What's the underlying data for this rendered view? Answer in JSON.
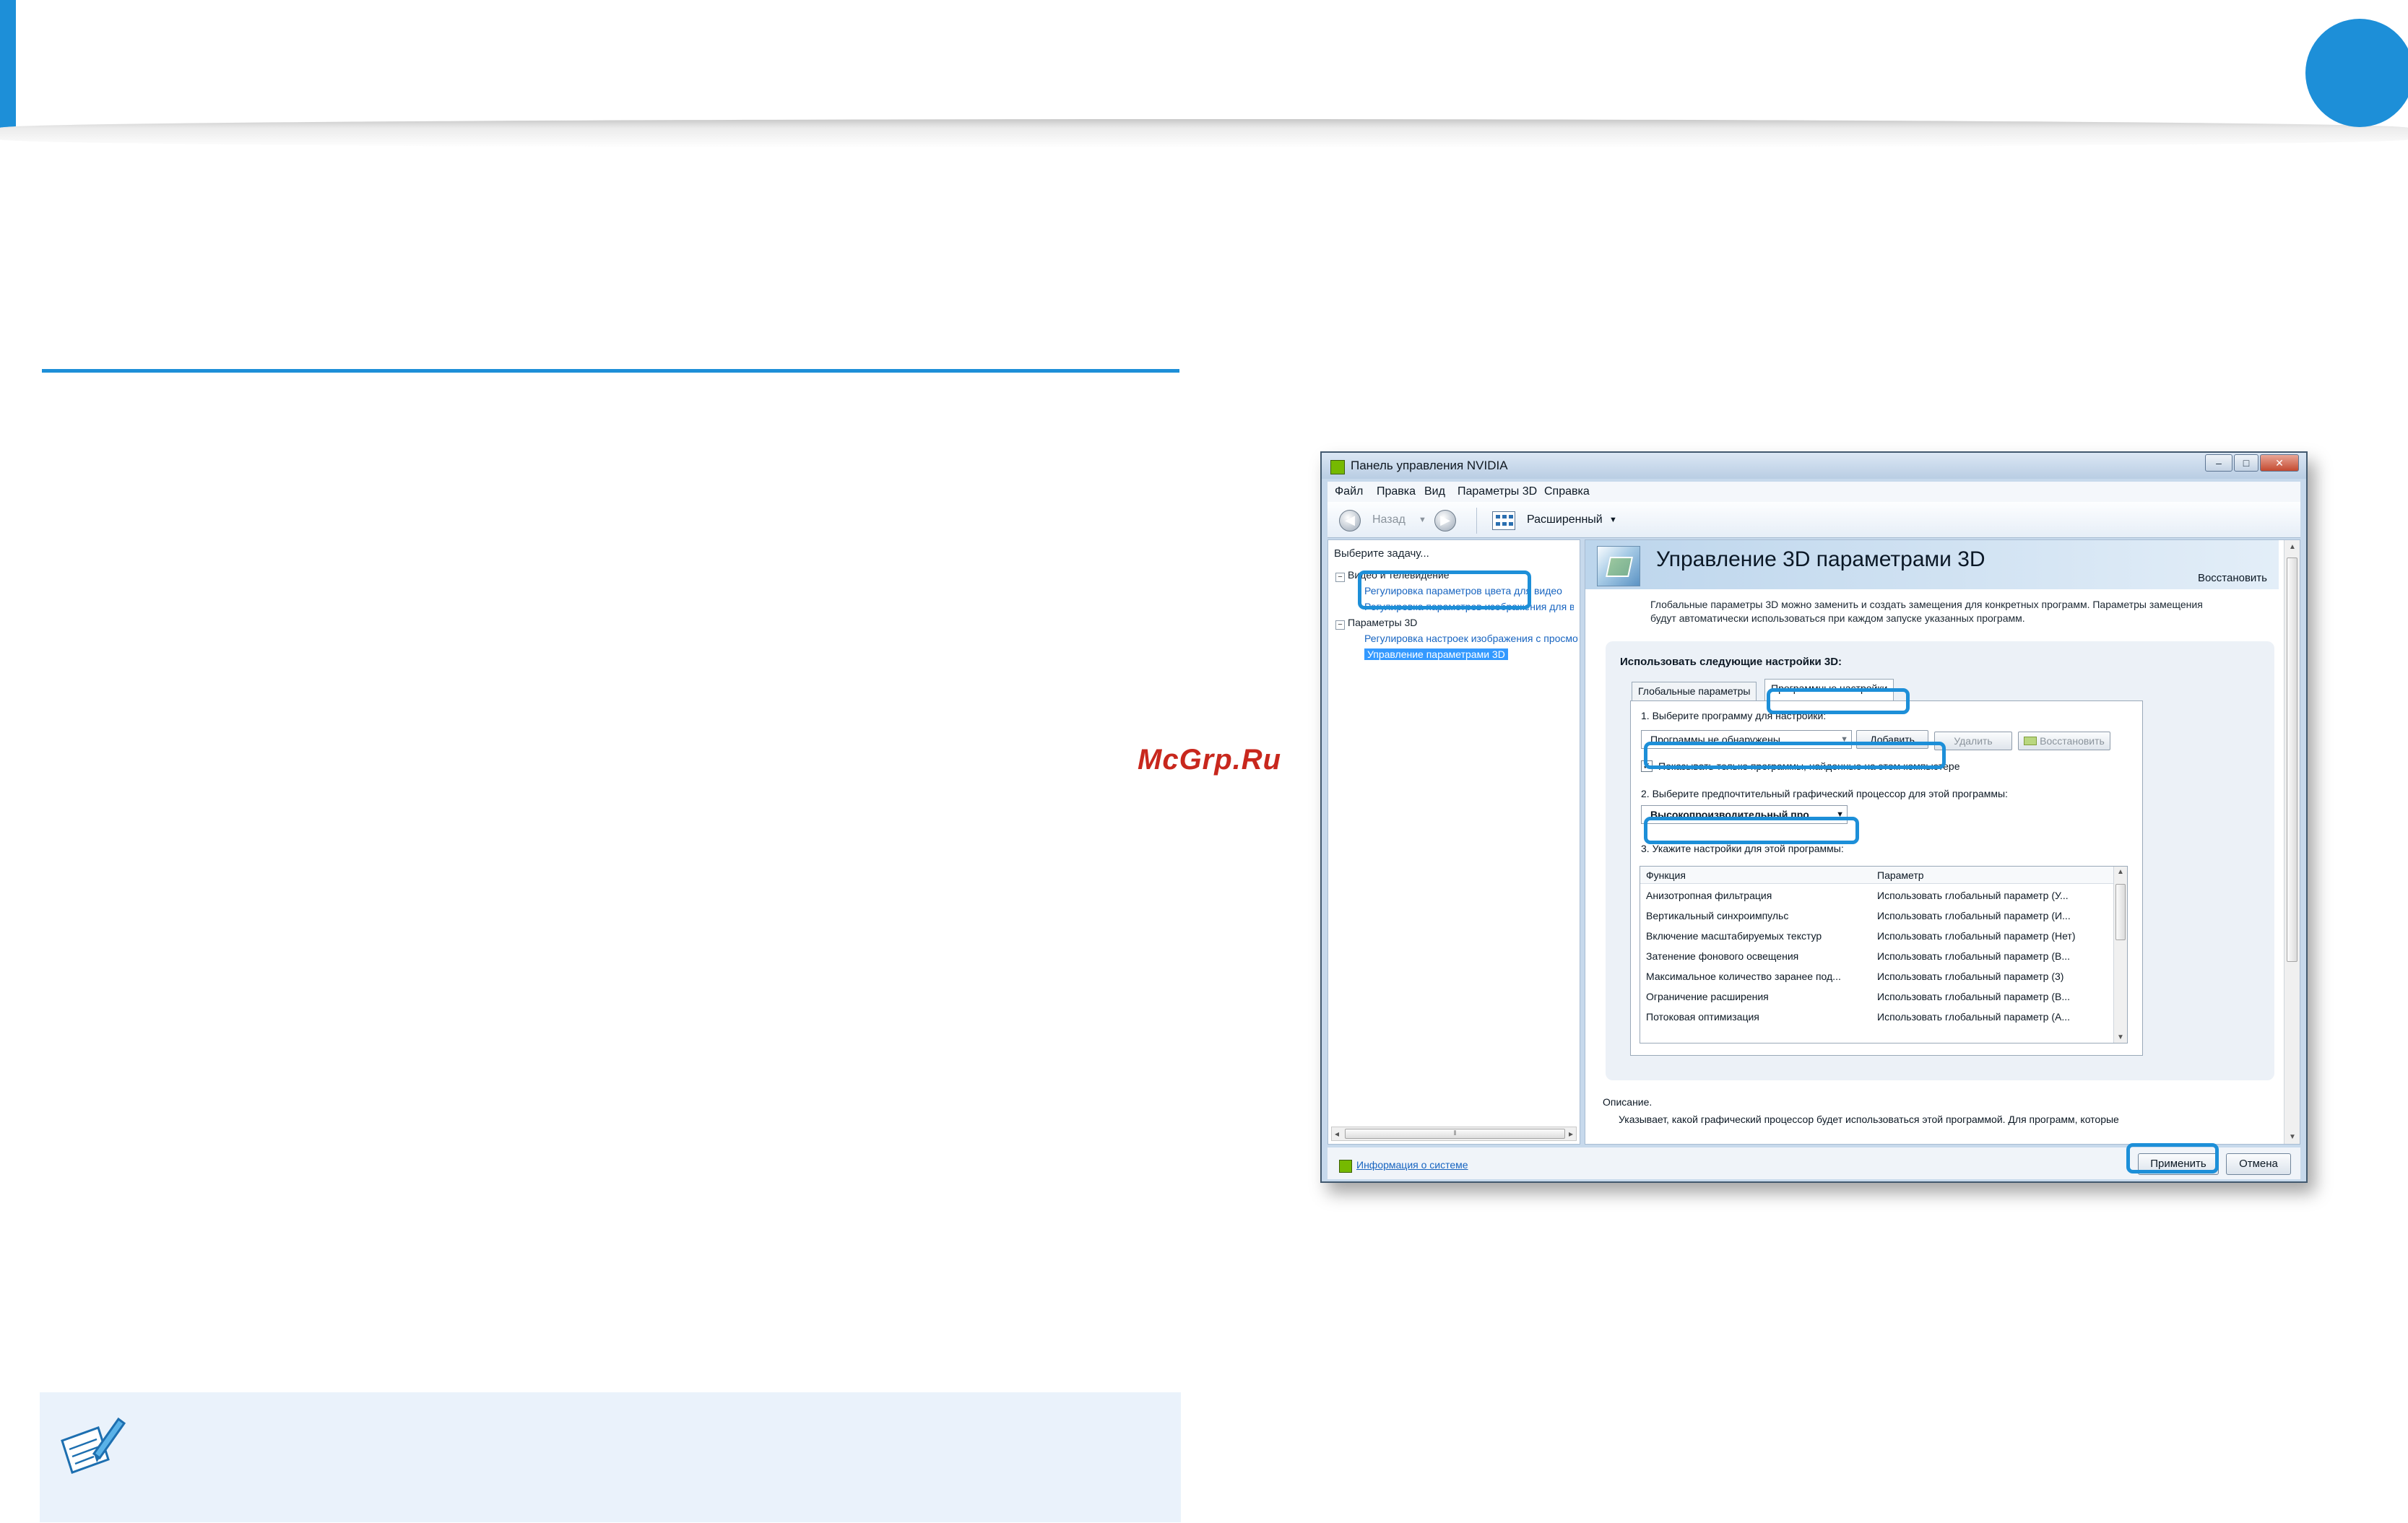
{
  "watermark": "McGrp.Ru",
  "window": {
    "title": "Панель управления NVIDIA",
    "controls": {
      "minimize": "–",
      "maximize": "□",
      "close": "✕"
    }
  },
  "menu": [
    "Файл",
    "Правка",
    "Вид",
    "Параметры 3D",
    "Справка"
  ],
  "toolbar": {
    "back_label": "Назад",
    "view_label": "Расширенный",
    "back_icon": "back-arrow-icon",
    "forward_icon": "forward-arrow-icon",
    "view_icon": "view-grid-icon"
  },
  "left_panel": {
    "title": "Выберите задачу...",
    "tree": [
      {
        "label": "Видео и телевидение",
        "kind": "group"
      },
      {
        "label": "Регулировка параметров цвета для видео",
        "kind": "link"
      },
      {
        "label": "Регулировка параметров изображения для видео",
        "kind": "link"
      },
      {
        "label": "Параметры 3D",
        "kind": "group"
      },
      {
        "label": "Регулировка настроек изображения с просмотром",
        "kind": "link"
      },
      {
        "label": "Управление параметрами 3D",
        "kind": "selected"
      }
    ]
  },
  "status": {
    "sysinfo_label": "Информация о системе",
    "apply_label": "Применить",
    "cancel_label": "Отмена"
  },
  "content": {
    "banner_title": "Управление 3D параметрами 3D",
    "restore_label": "Восстановить",
    "intro_line1": "Глобальные параметры 3D можно заменить и создать замещения для конкретных программ. Параметры замещения",
    "intro_line2": "будут автоматически использоваться при каждом запуске указанных программ.",
    "group_title": "Использовать следующие настройки 3D:",
    "tabs": [
      "Глобальные параметры",
      "Программные настройки"
    ],
    "step1_label": "1. Выберите программу для настройки:",
    "program_value": "Программы не обнаружены",
    "add_label": "Добавить",
    "remove_label": "Удалить",
    "restore_btn_label": "Восстановить",
    "checkbox_label": "Показывать только программы, найденные на этом компьютере",
    "checkbox_checked": true,
    "step2_label": "2. Выберите предпочтительный графический процессор для этой программы:",
    "gpu_value": "Высокопроизводительный про",
    "step3_label": "3. Укажите настройки для этой программы:",
    "table": {
      "headers": [
        "Функция",
        "Параметр"
      ],
      "rows": [
        [
          "Анизотропная фильтрация",
          "Использовать глобальный параметр (У..."
        ],
        [
          "Вертикальный синхроимпульс",
          "Использовать глобальный параметр (И..."
        ],
        [
          "Включение масштабируемых текстур",
          "Использовать глобальный параметр (Нет)"
        ],
        [
          "Затенение фонового освещения",
          "Использовать глобальный параметр (В..."
        ],
        [
          "Максимальное количество заранее под...",
          "Использовать глобальный параметр (3)"
        ],
        [
          "Ограничение расширения",
          "Использовать глобальный параметр (В..."
        ],
        [
          "Потоковая оптимизация",
          "Использовать глобальный параметр (А..."
        ]
      ]
    },
    "description_label": "Описание.",
    "description_text": "Указывает, какой графический процессор будет использоваться этой программой. Для программ, которые"
  },
  "colors": {
    "accent": "#1d8fd8",
    "watermark": "#c8271d",
    "nvidia_green": "#76b900"
  }
}
